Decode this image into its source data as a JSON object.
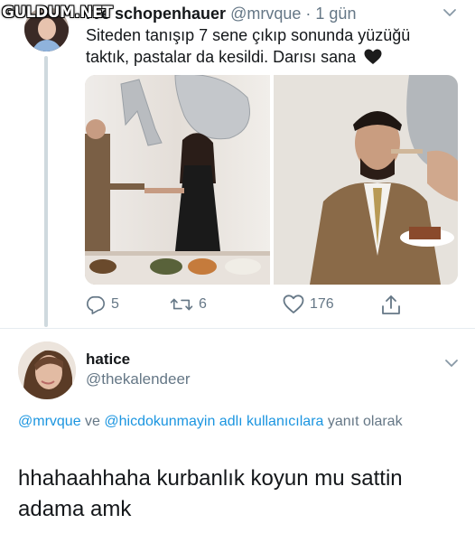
{
  "watermark": {
    "text": "GULDUM.NET"
  },
  "tweet1": {
    "display_name": "rve schopenhauer",
    "handle": "@mrvque",
    "separator": "·",
    "time": "1 gün",
    "text": "Siteden tanışıp 7 sene çıkıp sonunda yüzüğü taktık, pastalar da kesildi. Darısı sana",
    "emoji": "black-heart",
    "photos": [
      {
        "id": "left",
        "depicts": "couple-handshake-balloons"
      },
      {
        "id": "right",
        "depicts": "cake-feeding"
      }
    ],
    "actions": {
      "reply_count": "5",
      "retweet_count": "6",
      "like_count": "176"
    }
  },
  "tweet2": {
    "display_name": "hatice",
    "handle": "@thekalendeer",
    "reply_prefix": "",
    "mention1": "@mrvque",
    "reply_and": " ve ",
    "mention2": "@hicdokunmayin adlı kullanıcılara",
    "reply_suffix": " yanıt olarak",
    "text": "hhahaahhaha kurbanlık koyun mu sattin adama amk"
  },
  "colors": {
    "text": "#14171a",
    "muted": "#657786",
    "link": "#1b95e0",
    "divider": "#e6ecf0"
  }
}
